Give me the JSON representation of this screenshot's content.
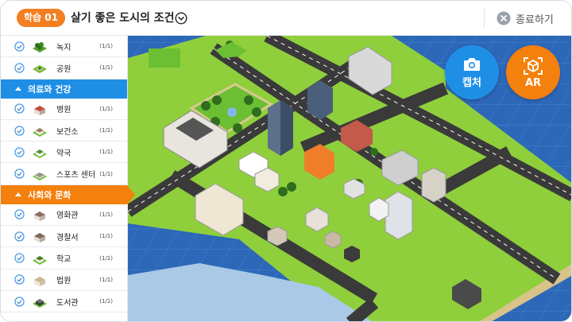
{
  "header": {
    "badge": "학습 01",
    "title": "살기 좋은 도시의 조건",
    "close_label": "종료하기"
  },
  "sidebar": {
    "items_top": [
      {
        "label": "녹지",
        "count": "(1/1)",
        "icon": "park-icon"
      },
      {
        "label": "공원",
        "count": "(1/1)",
        "icon": "garden-icon"
      }
    ],
    "section_health": {
      "label": "의료와 건강",
      "color": "#1f8fe6"
    },
    "items_health": [
      {
        "label": "병원",
        "count": "(1/1)",
        "icon": "hospital-icon"
      },
      {
        "label": "보건소",
        "count": "(1/1)",
        "icon": "clinic-icon"
      },
      {
        "label": "약국",
        "count": "(1/1)",
        "icon": "pharmacy-icon"
      },
      {
        "label": "스포츠 센터",
        "count": "(1/1)",
        "icon": "sports-center-icon"
      }
    ],
    "section_culture": {
      "label": "사회와 문화",
      "color": "#f4800e"
    },
    "items_culture": [
      {
        "label": "영화관",
        "count": "(1/1)",
        "icon": "cinema-icon"
      },
      {
        "label": "경찰서",
        "count": "(1/1)",
        "icon": "police-icon"
      },
      {
        "label": "학교",
        "count": "(1/1)",
        "icon": "school-icon"
      },
      {
        "label": "법원",
        "count": "(1/1)",
        "icon": "court-icon"
      },
      {
        "label": "도서관",
        "count": "(1/1)",
        "icon": "library-icon"
      }
    ]
  },
  "buttons": {
    "capture_label": "캡처",
    "ar_label": "AR"
  },
  "colors": {
    "accent_orange": "#f4800e",
    "accent_blue": "#1f8fe6",
    "sea": "#2d67b8",
    "grass": "#8fcf3c"
  }
}
